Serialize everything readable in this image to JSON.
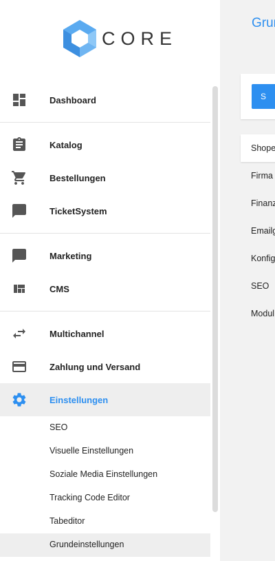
{
  "brand": {
    "name": "CORE",
    "colors": {
      "logo_light": "#8ec8f7",
      "logo_dark": "#3d8fe0"
    }
  },
  "colors": {
    "accent": "#2d8ff0",
    "active_bg": "#eeeeee"
  },
  "nav": {
    "items": [
      {
        "label": "Dashboard",
        "icon": "dashboard-icon"
      },
      {
        "label": "Katalog",
        "icon": "clipboard-icon"
      },
      {
        "label": "Bestellungen",
        "icon": "cart-icon"
      },
      {
        "label": "TicketSystem",
        "icon": "chat-icon"
      },
      {
        "label": "Marketing",
        "icon": "chat-icon"
      },
      {
        "label": "CMS",
        "icon": "layout-icon"
      },
      {
        "label": "Multichannel",
        "icon": "swap-arrows-icon"
      },
      {
        "label": "Zahlung und Versand",
        "icon": "credit-card-icon"
      },
      {
        "label": "Einstellungen",
        "icon": "gear-icon",
        "active": true
      }
    ],
    "subitems": [
      {
        "label": "SEO"
      },
      {
        "label": "Visuelle Einstellungen"
      },
      {
        "label": "Soziale Media Einstellungen"
      },
      {
        "label": "Tracking Code Editor"
      },
      {
        "label": "Tabeditor"
      },
      {
        "label": "Grundeinstellungen",
        "active": true
      }
    ]
  },
  "main": {
    "title": "Grun",
    "action_button": "S",
    "tabs": [
      {
        "label": "Shope",
        "active": true
      },
      {
        "label": "Firma"
      },
      {
        "label": "Finanz"
      },
      {
        "label": "Emailg"
      },
      {
        "label": "Konfig"
      },
      {
        "label": "SEO"
      },
      {
        "label": "Modul"
      }
    ]
  }
}
